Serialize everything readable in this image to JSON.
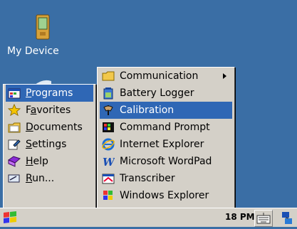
{
  "desktop": {
    "icons": [
      {
        "label": "My Device",
        "icon": "pda-device-icon"
      }
    ]
  },
  "start_menu": {
    "items": [
      {
        "label": "Programs",
        "icon": "programs-icon",
        "selected": true
      },
      {
        "label": "Favorites",
        "icon": "favorites-star-icon"
      },
      {
        "label": "Documents",
        "icon": "documents-folder-icon"
      },
      {
        "label": "Settings",
        "icon": "settings-icon"
      },
      {
        "label": "Help",
        "icon": "help-icon"
      },
      {
        "label": "Run...",
        "icon": "run-icon"
      }
    ]
  },
  "programs_submenu": {
    "items": [
      {
        "label": "Communication",
        "icon": "folder-icon",
        "has_submenu": true
      },
      {
        "label": "Battery Logger",
        "icon": "battery-icon"
      },
      {
        "label": "Calibration",
        "icon": "calibration-icon",
        "selected": true
      },
      {
        "label": "Command Prompt",
        "icon": "command-prompt-icon"
      },
      {
        "label": "Internet Explorer",
        "icon": "internet-explorer-icon"
      },
      {
        "label": "Microsoft WordPad",
        "icon": "wordpad-icon"
      },
      {
        "label": "Transcriber",
        "icon": "transcriber-icon"
      },
      {
        "label": "Windows Explorer",
        "icon": "windows-explorer-icon"
      }
    ]
  },
  "taskbar": {
    "clock": "18 PM",
    "start_icon": "windows-logo-icon",
    "tray_icons": [
      "keyboard-icon",
      "network-icon"
    ]
  },
  "colors": {
    "desktop": "#3a6ea5",
    "menu": "#d4d0c8",
    "highlight": "#2f67b5"
  }
}
